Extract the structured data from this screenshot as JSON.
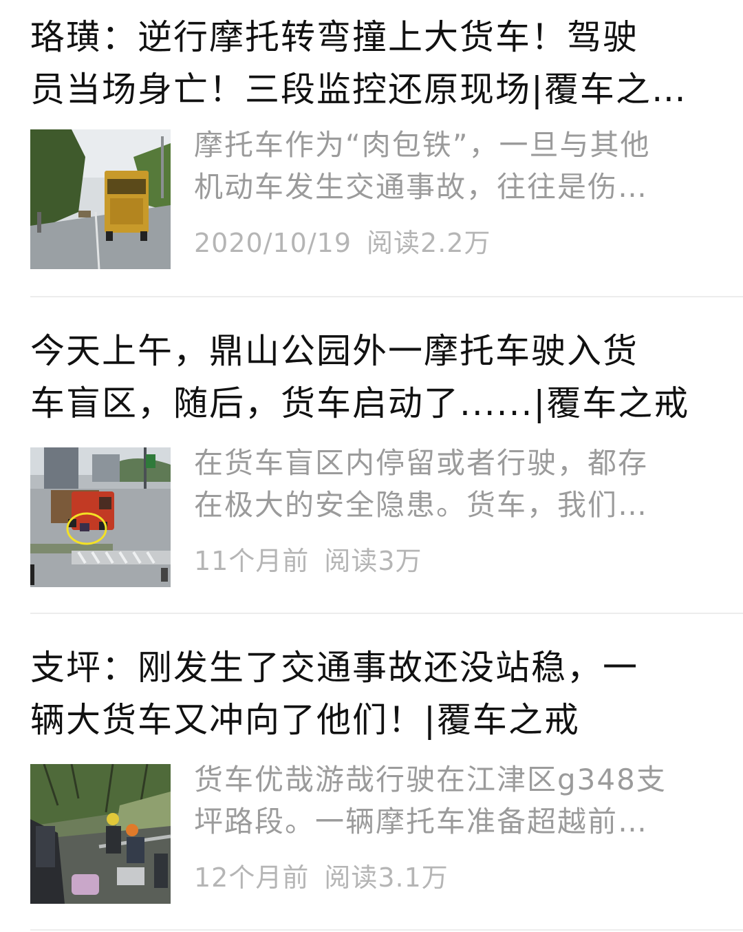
{
  "articles": [
    {
      "title_line1": "珞璜：逆行摩托转弯撞上大货车！驾驶",
      "title_line2": "员当场身亡！三段监控还原现场|覆车之…",
      "summary_line1": "摩托车作为“肉包铁”，一旦与其他",
      "summary_line2": "机动车发生交通事故，往往是伤…",
      "date": "2020/10/19",
      "views": "阅读2.2万",
      "thumbnail_icon": "yellow-truck-on-road-photo"
    },
    {
      "title_line1": "今天上午，鼎山公园外一摩托车驶入货",
      "title_line2": "车盲区，随后，货车启动了......|覆车之戒",
      "summary_line1": "在货车盲区内停留或者行驶，都存",
      "summary_line2": "在极大的安全隐患。货车，我们…",
      "date": "11个月前",
      "views": "阅读3万",
      "thumbnail_icon": "red-truck-intersection-photo"
    },
    {
      "title_line1": "支坪：刚发生了交通事故还没站稳，一",
      "title_line2": "辆大货车又冲向了他们！|覆车之戒",
      "summary_line1": "货车优哉游哉行驶在江津区g348支",
      "summary_line2": "坪路段。一辆摩托车准备超越前…",
      "date": "12个月前",
      "views": "阅读3.1万",
      "thumbnail_icon": "roadside-accident-photo"
    }
  ]
}
